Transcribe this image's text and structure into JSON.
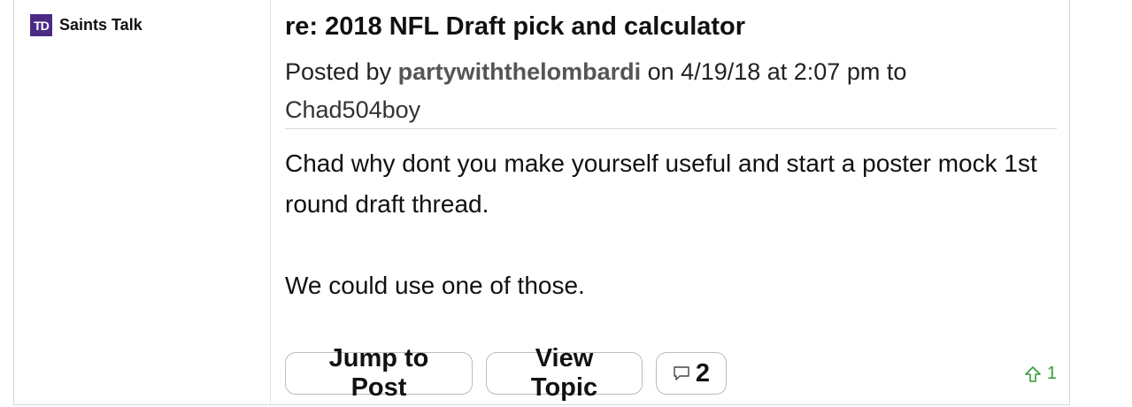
{
  "sidebar": {
    "board_logo_text": "TD",
    "board_name": "Saints Talk",
    "logo_color": "#4b2a85"
  },
  "post": {
    "title": "re: 2018 NFL Draft pick and calculator",
    "meta_prefix": "Posted by",
    "author": "partywiththelombardi",
    "meta_middle": "on 4/19/18 at 2:07 pm to",
    "recipient": "Chad504boy",
    "body_paragraphs": [
      "Chad why dont you make yourself useful and start a poster mock 1st round draft thread.",
      "We could use one of those."
    ]
  },
  "actions": {
    "jump_label": "Jump to Post",
    "view_label": "View Topic",
    "reply_count": "2",
    "reply_icon": "speech-bubble-icon"
  },
  "vote": {
    "up_icon": "upvote-arrow-icon",
    "count": "1",
    "color": "#3a9a3a"
  }
}
